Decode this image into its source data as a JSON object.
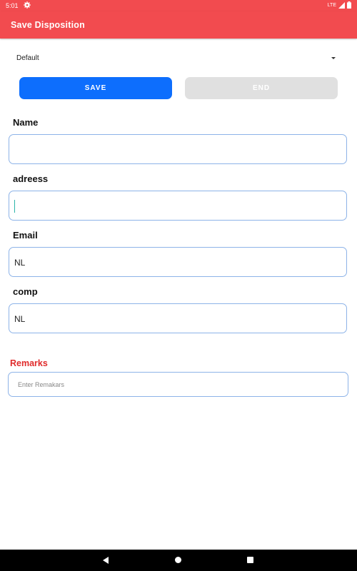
{
  "status_bar": {
    "time": "5:01",
    "network": "LTE",
    "icons": [
      "gear-icon",
      "lte-signal-icon",
      "battery-icon"
    ]
  },
  "app_bar": {
    "title": "Save Disposition",
    "color": "#f24b4f"
  },
  "disposition_dropdown": {
    "selected": "Default"
  },
  "actions": {
    "save_label": "SAVE",
    "end_label": "END",
    "save_color": "#0d6efd",
    "end_color": "#e0e0e0"
  },
  "fields": [
    {
      "label": "Name",
      "value": ""
    },
    {
      "label": "adreess",
      "value": ""
    },
    {
      "label": "Email",
      "value": "NL"
    },
    {
      "label": "comp",
      "value": "NL"
    }
  ],
  "remarks": {
    "label": "Remarks",
    "placeholder": "Enter Remakars",
    "label_color": "#e02b2b"
  },
  "nav_bar": {
    "icons": [
      "back-icon",
      "home-icon",
      "recents-icon"
    ]
  }
}
